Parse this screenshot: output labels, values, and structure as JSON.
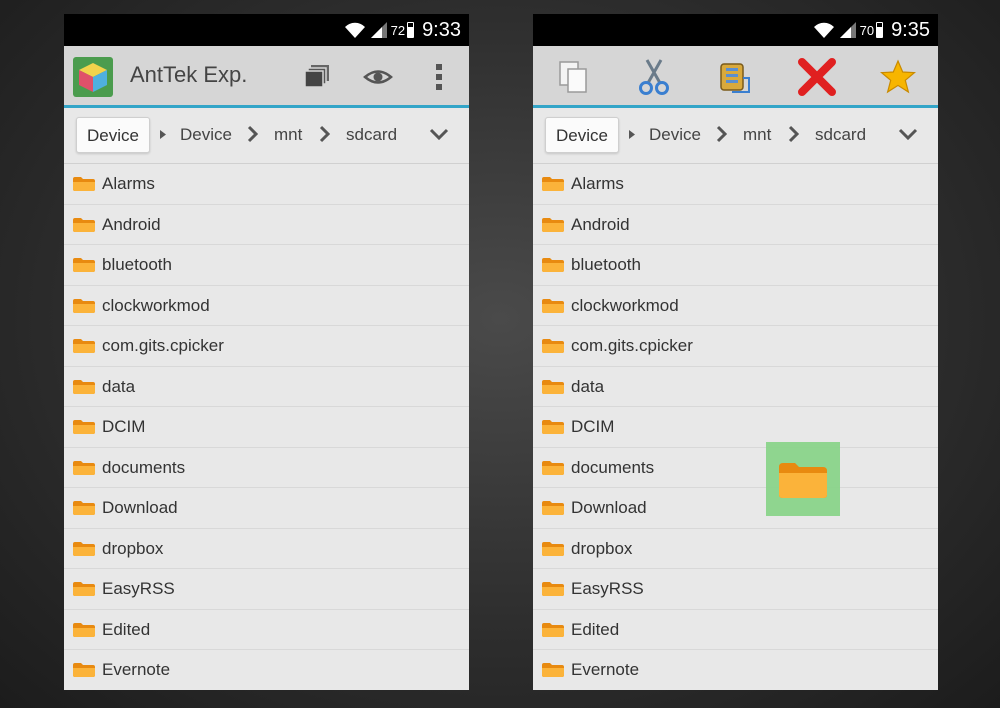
{
  "left_screen": {
    "status": {
      "battery": "72",
      "time": "9:33"
    },
    "app_title": "AntTek Exp.",
    "path": {
      "device_button": "Device",
      "crumbs": [
        "Device",
        "mnt",
        "sdcard"
      ]
    },
    "files": [
      "Alarms",
      "Android",
      "bluetooth",
      "clockworkmod",
      "com.gits.cpicker",
      "data",
      "DCIM",
      "documents",
      "Download",
      "dropbox",
      "EasyRSS",
      "Edited",
      "Evernote"
    ]
  },
  "right_screen": {
    "status": {
      "battery": "70",
      "time": "9:35"
    },
    "toolbar_icons": [
      "copy-icon",
      "cut-icon",
      "compress-icon",
      "delete-icon",
      "favorite-star-icon"
    ],
    "path": {
      "device_button": "Device",
      "crumbs": [
        "Device",
        "mnt",
        "sdcard"
      ]
    },
    "files": [
      "Alarms",
      "Android",
      "bluetooth",
      "clockworkmod",
      "com.gits.cpicker",
      "data",
      "DCIM",
      "documents",
      "Download",
      "dropbox",
      "EasyRSS",
      "Edited",
      "Evernote"
    ]
  },
  "colors": {
    "accent_line": "#33a5c8",
    "folder": "#f6a21d",
    "drag_highlight": "#8ad48a",
    "delete": "#e02020",
    "star": "#f7b500"
  }
}
